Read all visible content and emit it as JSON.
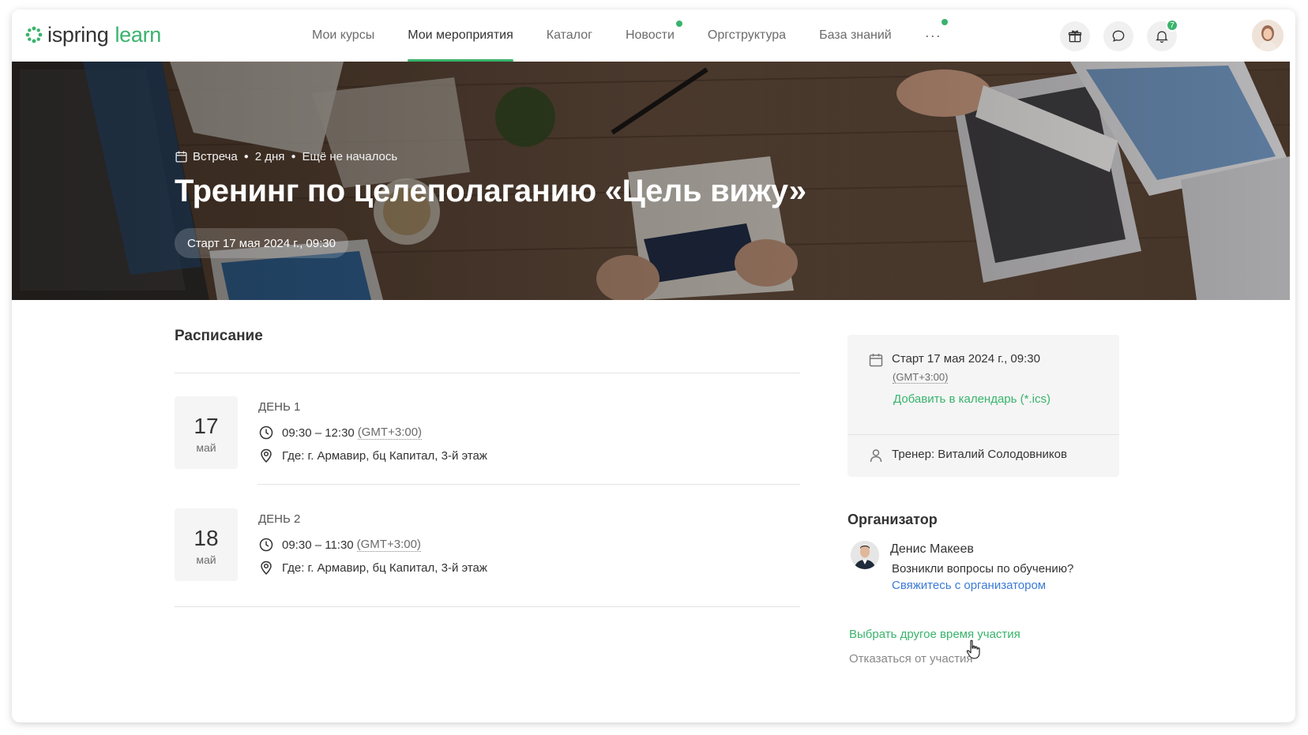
{
  "header": {
    "logo": {
      "part1": "ispring",
      "part2": "learn"
    },
    "nav": [
      {
        "label": "Мои курсы",
        "active": false,
        "dot": false
      },
      {
        "label": "Мои мероприятия",
        "active": true,
        "dot": false
      },
      {
        "label": "Каталог",
        "active": false,
        "dot": false
      },
      {
        "label": "Новости",
        "active": false,
        "dot": true
      },
      {
        "label": "Оргструктура",
        "active": false,
        "dot": false
      },
      {
        "label": "База знаний",
        "active": false,
        "dot": false
      }
    ],
    "more_label": "···",
    "notifications_count": "7",
    "icons": [
      "gift-icon",
      "chat-icon",
      "bell-icon",
      "user-avatar"
    ]
  },
  "hero": {
    "type": "Встреча",
    "duration": "2 дня",
    "status": "Ещё не началось",
    "title": "Тренинг по целеполаганию «Цель вижу»",
    "start": "Старт 17 мая 2024 г., 09:30"
  },
  "schedule": {
    "title": "Расписание",
    "days": [
      {
        "day_num": "17",
        "month": "май",
        "label": "ДЕНЬ 1",
        "time": "09:30 – 12:30",
        "tz": "(GMT+3:00)",
        "location": "Где: г. Армавир, бц Капитал, 3-й этаж"
      },
      {
        "day_num": "18",
        "month": "май",
        "label": "ДЕНЬ 2",
        "time": "09:30 – 11:30",
        "tz": "(GMT+3:00)",
        "location": "Где: г. Армавир, бц Капитал, 3-й этаж"
      }
    ]
  },
  "sidebar": {
    "start": "Старт 17 мая 2024 г., 09:30",
    "tz": "(GMT+3:00)",
    "add_calendar": "Добавить в календарь (*.ics)",
    "trainer": "Тренер: Виталий Солодовников"
  },
  "organizer": {
    "title": "Организатор",
    "name": "Денис Макеев",
    "question": "Возникли вопросы по обучению?",
    "contact_link": "Свяжитесь с организатором"
  },
  "actions": {
    "change_time": "Выбрать другое время участия",
    "decline": "Отказаться от участия"
  },
  "colors": {
    "accent": "#39b36c",
    "link_blue": "#3a7bd5",
    "muted": "#888888"
  }
}
